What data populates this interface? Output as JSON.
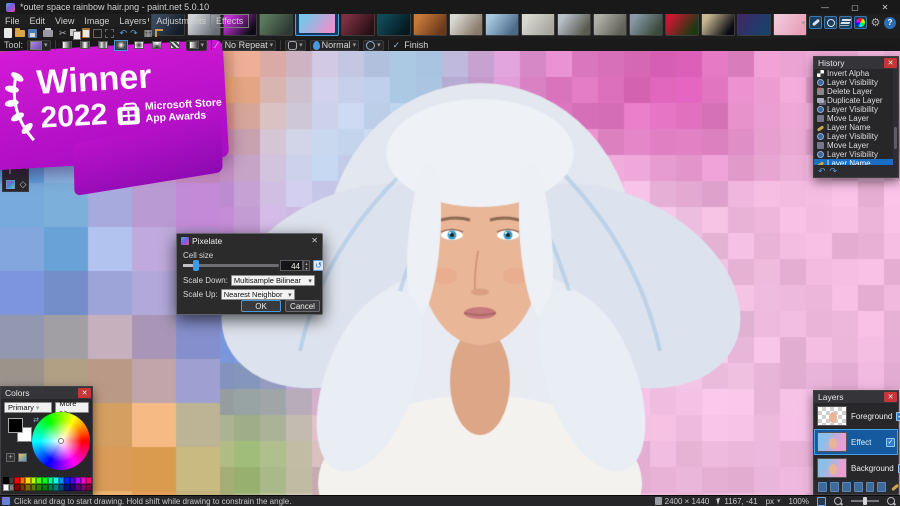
{
  "window": {
    "title": "*outer space rainbow hair.png - paint.net 5.0.10"
  },
  "icons": {
    "minimize": "—",
    "maximize": "▢",
    "close": "✕",
    "dropdown": "▾",
    "chevron_left": "◂",
    "check": "✓",
    "scissors": "✂",
    "undo": "↶",
    "redo": "↷",
    "grid": "▦",
    "reset": "↺",
    "spin": "▴▾",
    "question": "?",
    "gear": "⚙",
    "slash": "∕"
  },
  "menu": {
    "items": [
      "File",
      "Edit",
      "View",
      "Image",
      "Layers",
      "Adjustments",
      "Effects"
    ]
  },
  "tool_options": {
    "label": "Tool:",
    "no_repeat": "No Repeat",
    "normal": "Normal",
    "finish": "Finish"
  },
  "thumbnails": [
    {
      "c1": "#3a4a5e",
      "c2": "#141c28",
      "active": false
    },
    {
      "c1": "#cfd3d8",
      "c2": "#6a6f76",
      "active": false
    },
    {
      "c1": "#c330d8",
      "c2": "#0c0c14",
      "active": false
    },
    {
      "c1": "#5a7a5e",
      "c2": "#2e3a30",
      "active": false
    },
    {
      "c1": "#7ac4e8",
      "c2": "#e892ce",
      "active": true
    },
    {
      "c1": "#7a3040",
      "c2": "#2a1016",
      "active": false
    },
    {
      "c1": "#0e4a56",
      "c2": "#061820",
      "active": false
    },
    {
      "c1": "#c87a3a",
      "c2": "#6a3a1a",
      "active": false
    },
    {
      "c1": "#d8d8d4",
      "c2": "#8a7a6a",
      "active": false
    },
    {
      "c1": "#a8c8e0",
      "c2": "#4a6a8a",
      "active": false
    },
    {
      "c1": "#d8d8d0",
      "c2": "#a8a8a0",
      "active": false
    },
    {
      "c1": "#b8c0c8",
      "c2": "#5a5a50",
      "active": false
    },
    {
      "c1": "#b0b0a8",
      "c2": "#606058",
      "active": false
    },
    {
      "c1": "#8898a8",
      "c2": "#3a4a3a",
      "active": false
    },
    {
      "c1": "#c81830",
      "c2": "#1a3a10",
      "active": false
    },
    {
      "c1": "#c8b890",
      "c2": "#0a0a12",
      "active": false
    },
    {
      "c1": "#3a2a6a",
      "c2": "#18426a",
      "active": false
    },
    {
      "c1": "#f0c8d8",
      "c2": "#e8a0b8",
      "active": false
    }
  ],
  "history": {
    "title": "History",
    "items": [
      {
        "icon": "invert-alpha",
        "label": "Invert Alpha",
        "selected": false
      },
      {
        "icon": "visibility",
        "label": "Layer Visibility",
        "selected": false
      },
      {
        "icon": "delete",
        "label": "Delete Layer",
        "selected": false
      },
      {
        "icon": "duplicate",
        "label": "Duplicate Layer",
        "selected": false
      },
      {
        "icon": "visibility",
        "label": "Layer Visibility",
        "selected": false
      },
      {
        "icon": "move",
        "label": "Move Layer",
        "selected": false
      },
      {
        "icon": "name",
        "label": "Layer Name",
        "selected": false
      },
      {
        "icon": "visibility",
        "label": "Layer Visibility",
        "selected": false
      },
      {
        "icon": "move",
        "label": "Move Layer",
        "selected": false
      },
      {
        "icon": "visibility",
        "label": "Layer Visibility",
        "selected": false
      },
      {
        "icon": "name",
        "label": "Layer Name",
        "selected": true
      }
    ]
  },
  "layers_panel": {
    "title": "Layers",
    "layers": [
      {
        "name": "Foreground",
        "checked": true,
        "selected": false,
        "transparent": true
      },
      {
        "name": "Effect",
        "checked": true,
        "selected": true,
        "transparent": false
      },
      {
        "name": "Background",
        "checked": true,
        "selected": false,
        "transparent": false
      }
    ]
  },
  "colors_panel": {
    "title": "Colors",
    "mode": "Primary",
    "more_label": "More >>",
    "palette": [
      [
        "#000000",
        "#404040",
        "#FF0000",
        "#FF6A00",
        "#FFD800",
        "#B6FF00",
        "#4CFF00",
        "#00FF21",
        "#00FF90",
        "#00FFFF",
        "#0094FF",
        "#0026FF",
        "#4800FF",
        "#B200FF",
        "#FF00DC",
        "#FF006E"
      ],
      [
        "#FFFFFF",
        "#808080",
        "#7F0000",
        "#7F3300",
        "#7F6A00",
        "#5B7F00",
        "#267F00",
        "#007F0E",
        "#007F46",
        "#007F7F",
        "#004A7F",
        "#00137F",
        "#21007F",
        "#57007F",
        "#7F006E",
        "#7F0037"
      ]
    ]
  },
  "banner": {
    "winner": "Winner",
    "year": "2022",
    "store_line1": "Microsoft Store",
    "store_line2": "App Awards"
  },
  "dialog": {
    "title": "Pixelate",
    "cell_size_label": "Cell size",
    "cell_size_value": "44",
    "scale_down_label": "Scale Down:",
    "scale_down_value": "Multisample Bilinear",
    "scale_up_label": "Scale Up:",
    "scale_up_value": "Nearest Neighbor",
    "ok_label": "OK",
    "cancel_label": "Cancel"
  },
  "status": {
    "hint": "Click and drag to start drawing. Hold shift while drawing to constrain the angle.",
    "image_size": "2400 × 1440",
    "cursor_pos": "1167, -41",
    "unit": "px",
    "zoom": "100%"
  }
}
